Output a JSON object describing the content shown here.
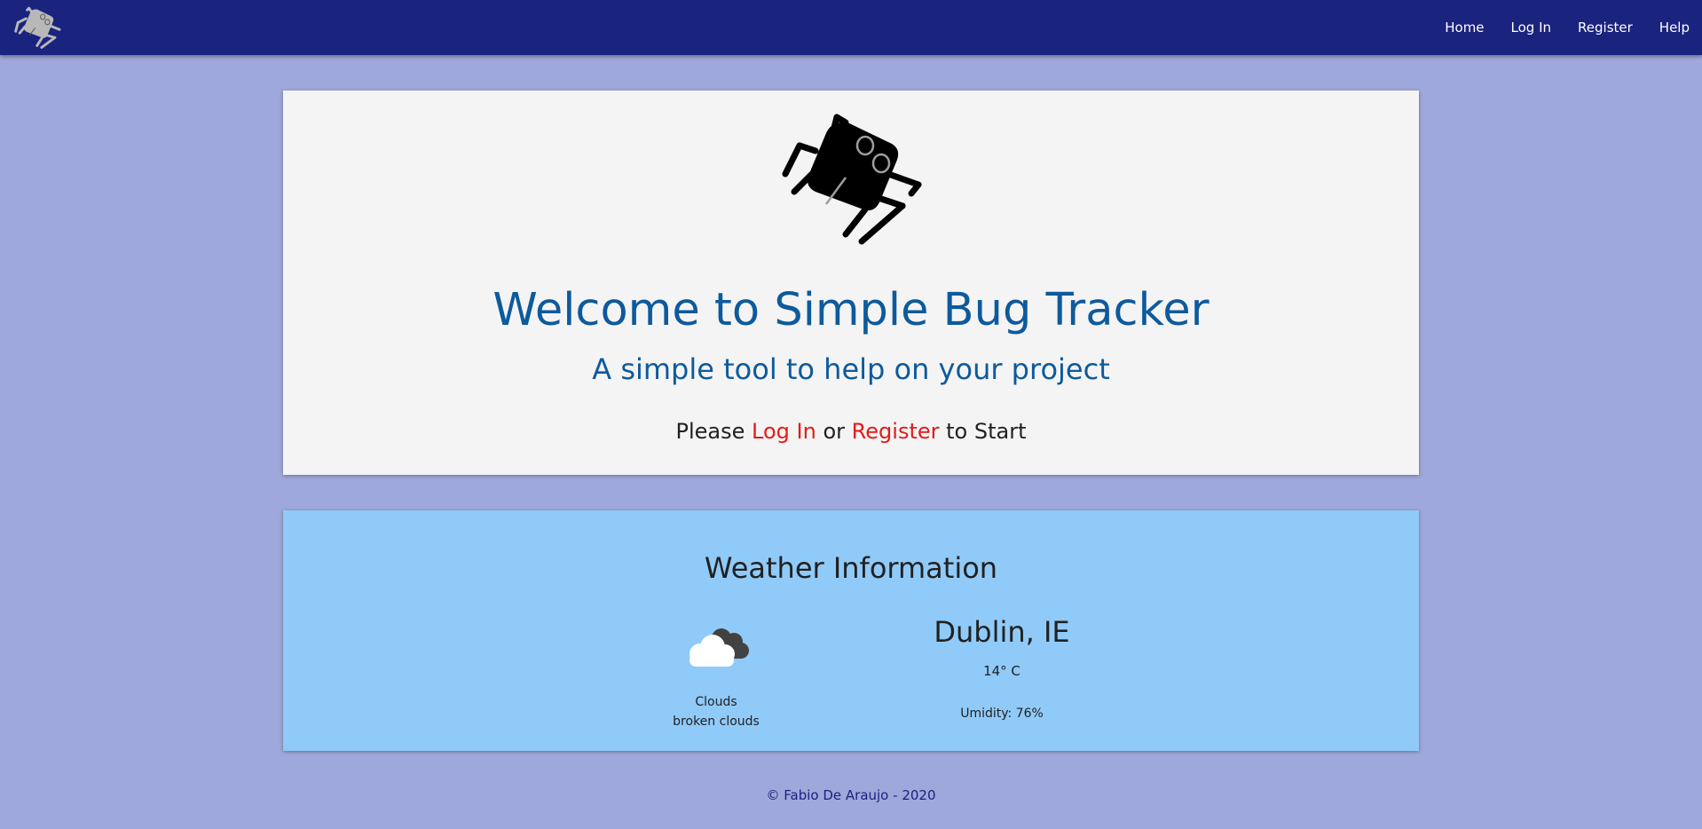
{
  "nav": {
    "logo_icon": "bug-icon",
    "links": [
      "Home",
      "Log In",
      "Register",
      "Help"
    ]
  },
  "welcome": {
    "logo_icon": "bug-icon",
    "title": "Welcome to Simple Bug Tracker",
    "subtitle": "A simple tool to help on your project",
    "prompt_prefix": "Please",
    "login_link": "Log In",
    "prompt_or": "or",
    "register_link": "Register",
    "prompt_suffix": "to Start"
  },
  "weather": {
    "title": "Weather Information",
    "icon": "broken-clouds-icon",
    "condition": "Clouds",
    "description": "broken clouds",
    "city": "Dublin, IE",
    "temperature": "14° C",
    "humidity": "Umidity: 76%"
  },
  "footer": {
    "text": "© Fabio De Araujo - 2020"
  },
  "colors": {
    "navbar": "#1a237e",
    "page_background": "#9fa8da",
    "welcome_card": "#f4f4f4",
    "weather_card": "#90caf9",
    "title_blue": "#0d5a9c",
    "link_red": "#e41b17"
  }
}
